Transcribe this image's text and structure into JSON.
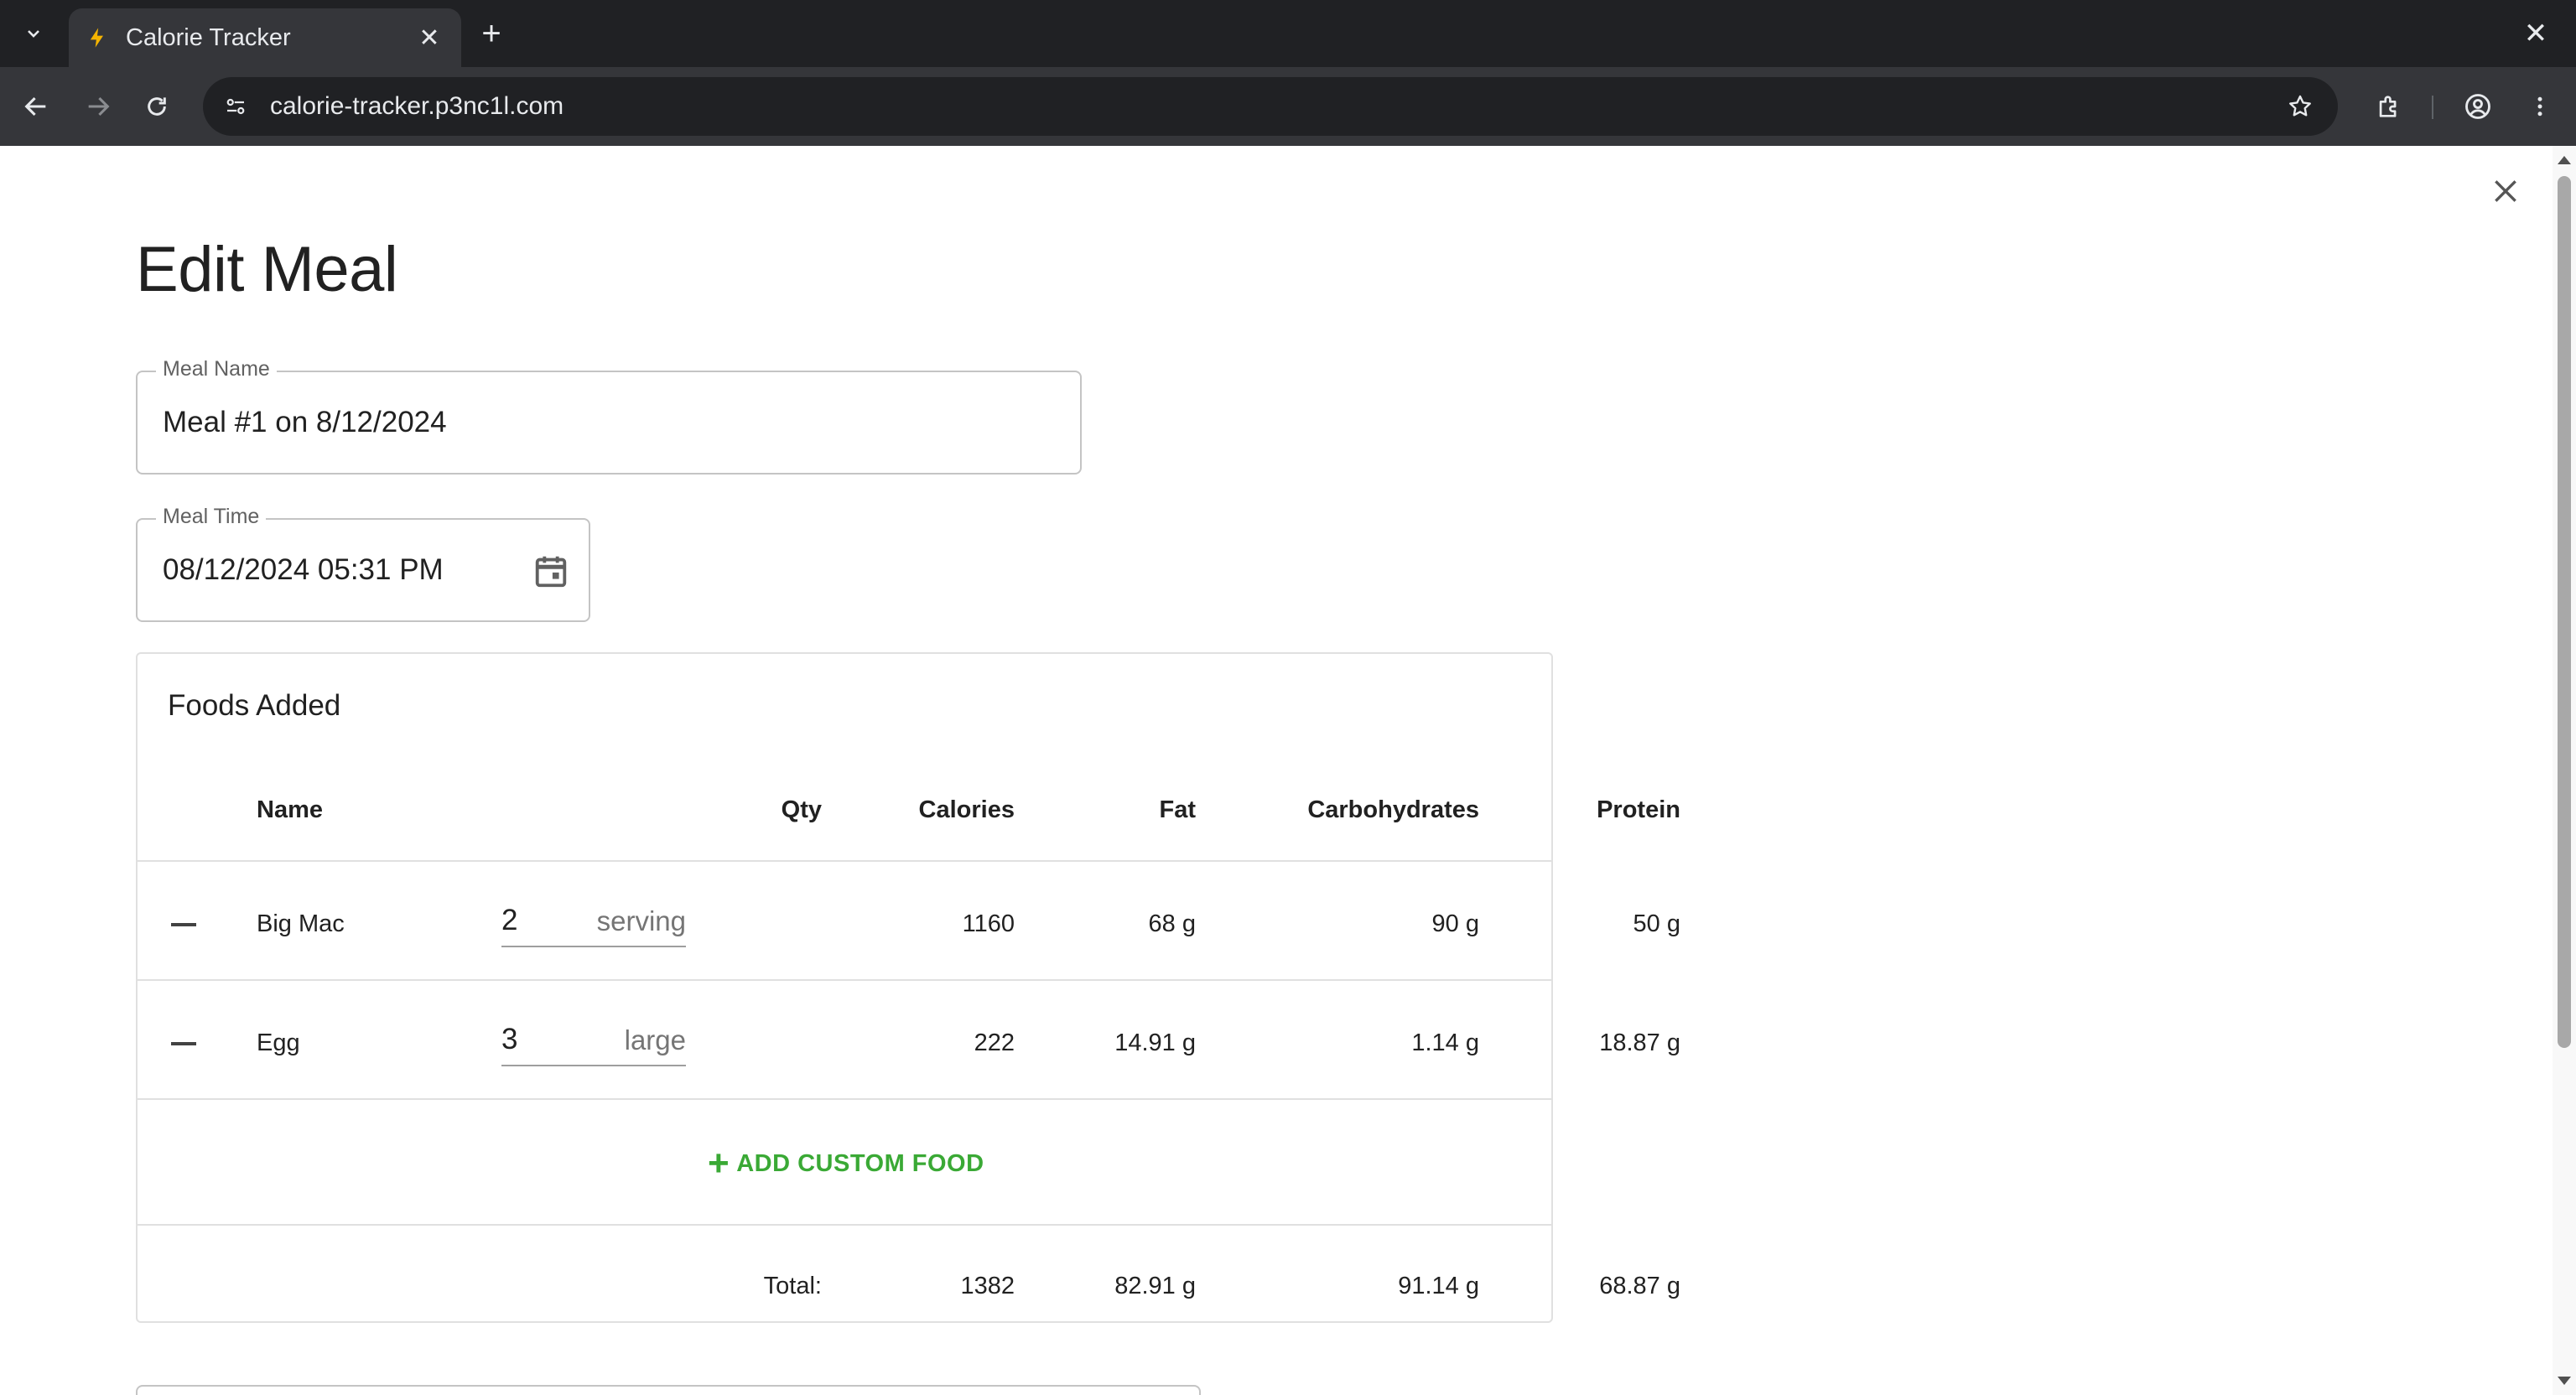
{
  "browser": {
    "tab_title": "Calorie Tracker",
    "tab_close": "✕",
    "new_tab": "+",
    "window_close": "✕",
    "url": "calorie-tracker.p3nc1l.com"
  },
  "dialog": {
    "title": "Edit Meal",
    "meal_name": {
      "label": "Meal Name",
      "value": "Meal #1 on 8/12/2024"
    },
    "meal_time": {
      "label": "Meal Time",
      "value": "08/12/2024 05:31 PM"
    }
  },
  "foods": {
    "title": "Foods Added",
    "headers": {
      "name": "Name",
      "qty": "Qty",
      "calories": "Calories",
      "fat": "Fat",
      "carbs": "Carbohydrates",
      "protein": "Protein"
    },
    "rows": [
      {
        "name": "Big Mac",
        "qty": "2",
        "unit": "serving",
        "calories": "1160",
        "fat": "68 g",
        "carbs": "90 g",
        "protein": "50 g"
      },
      {
        "name": "Egg",
        "qty": "3",
        "unit": "large",
        "calories": "222",
        "fat": "14.91 g",
        "carbs": "1.14 g",
        "protein": "18.87 g"
      }
    ],
    "add_custom": "ADD CUSTOM FOOD",
    "total": {
      "label": "Total:",
      "calories": "1382",
      "fat": "82.91 g",
      "carbs": "91.14 g",
      "protein": "68.87 g"
    }
  },
  "colors": {
    "accent": "#3aa935",
    "chrome_dark": "#202124",
    "chrome_toolbar": "#35363a"
  }
}
